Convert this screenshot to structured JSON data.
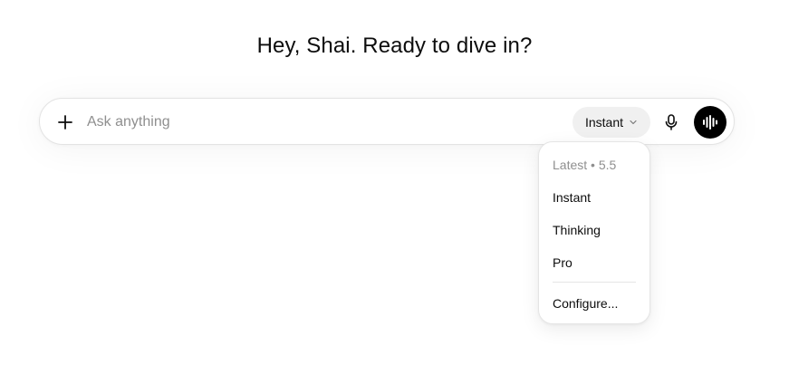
{
  "greeting": "Hey, Shai. Ready to dive in?",
  "composer": {
    "placeholder": "Ask anything",
    "value": "",
    "model_selected": "Instant"
  },
  "icons": {
    "add": "plus-icon",
    "chevron": "chevron-down-icon",
    "mic": "microphone-icon",
    "voice": "voice-waveform-icon"
  },
  "dropdown": {
    "header": "Latest • 5.5",
    "items": [
      {
        "label": "Instant"
      },
      {
        "label": "Thinking"
      },
      {
        "label": "Pro"
      }
    ],
    "configure_label": "Configure..."
  },
  "colors": {
    "voice_button": "#000000",
    "pill_background": "#f0f0f0",
    "muted_text": "#8f8f8f"
  }
}
